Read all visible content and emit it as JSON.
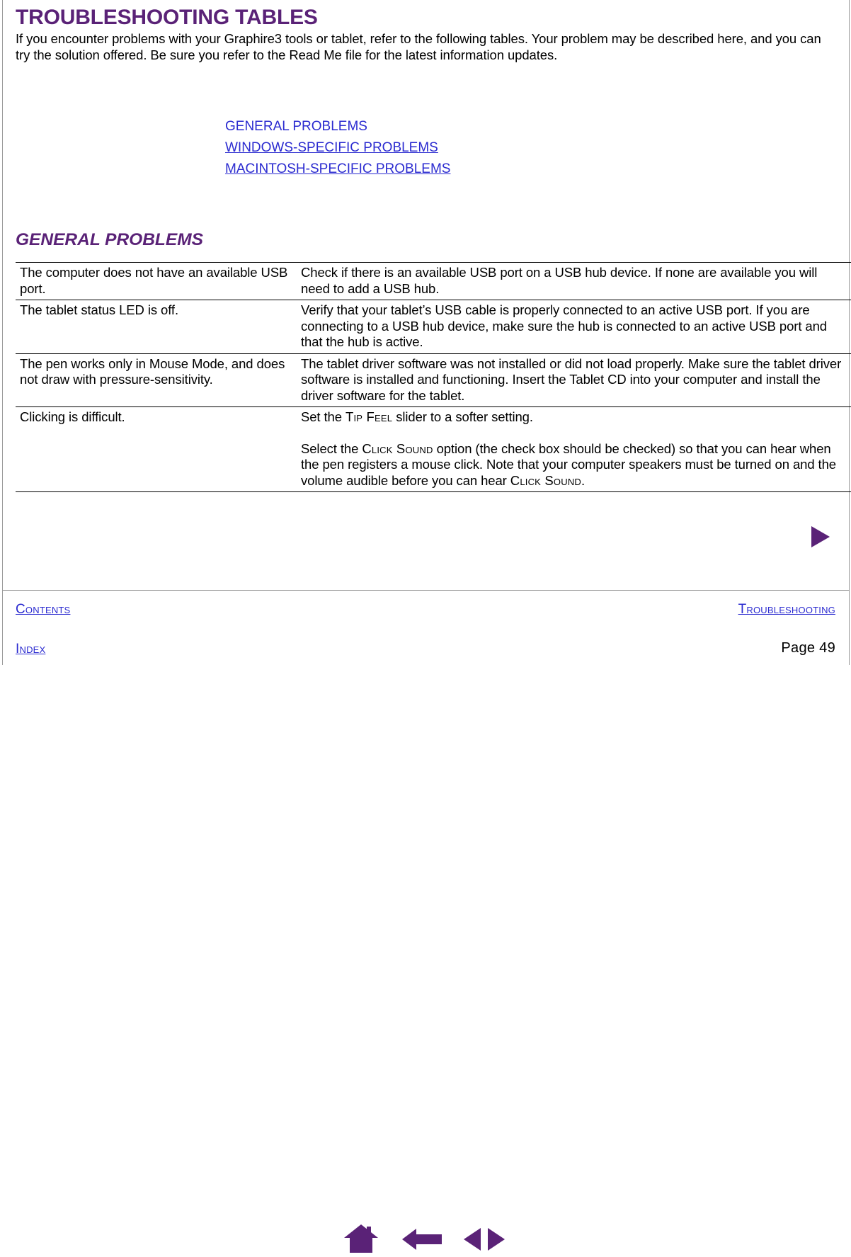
{
  "document": {
    "title": "TROUBLESHOOTING TABLES",
    "intro": "If you encounter problems with your Graphire3 tools or tablet, refer to the following tables.  Your problem may be described here, and you can try the solution offered.  Be sure you refer to the Read Me file for the latest information updates.",
    "accent_color": "#5a2277",
    "link_color": "#2b2bd0"
  },
  "links": [
    {
      "label": "GENERAL PROBLEMS",
      "underlined": false
    },
    {
      "label": "WINDOWS-SPECIFIC PROBLEMS",
      "underlined": true
    },
    {
      "label": "MACINTOSH-SPECIFIC PROBLEMS",
      "underlined": true
    }
  ],
  "section": {
    "heading": "GENERAL PROBLEMS"
  },
  "table": {
    "rows": [
      {
        "problem": "The computer does not have an available USB port.",
        "solution_parts": [
          {
            "text": "Check if there is an available USB port on a USB hub device.  If none are available you will need to add a USB hub."
          }
        ]
      },
      {
        "problem": "The tablet status LED is off.",
        "solution_parts": [
          {
            "text": "Verify that your tablet’s USB cable is properly connected to an active USB port.  If you are connecting to a USB hub device, make sure the hub is connected to an active USB port and that the hub is active."
          }
        ]
      },
      {
        "problem": "The pen works only in Mouse Mode, and does not draw with pressure-sensitivity.",
        "solution_parts": [
          {
            "text": "The tablet driver software was not installed or did not load properly. Make sure the tablet driver software is installed and functioning.  Insert the Tablet CD into your computer and install the driver software for the tablet."
          }
        ]
      },
      {
        "problem": "Clicking is difficult.",
        "solution_parts": [
          {
            "pre": "Set the ",
            "smallcaps": "Tip Feel",
            "post": " slider to a softer setting."
          },
          {
            "pre": "Select the ",
            "smallcaps": "Click Sound",
            "post": " option (the check box should be checked) so that you can hear when the pen registers a mouse click.  Note that your computer speakers must be turned on and the volume audible before you can hear ",
            "smallcaps2": "Click Sound",
            "post2": "."
          }
        ]
      }
    ]
  },
  "footer": {
    "contents_label": "Contents",
    "index_label": "Index",
    "chapter_label": "Troubleshooting",
    "page_label": "Page  49"
  },
  "nav": {
    "home_icon": "home-icon",
    "back_icon": "back-arrow-icon",
    "prev_icon": "previous-page-icon",
    "next_icon": "next-page-icon",
    "next_section_icon": "next-section-arrow-icon"
  }
}
